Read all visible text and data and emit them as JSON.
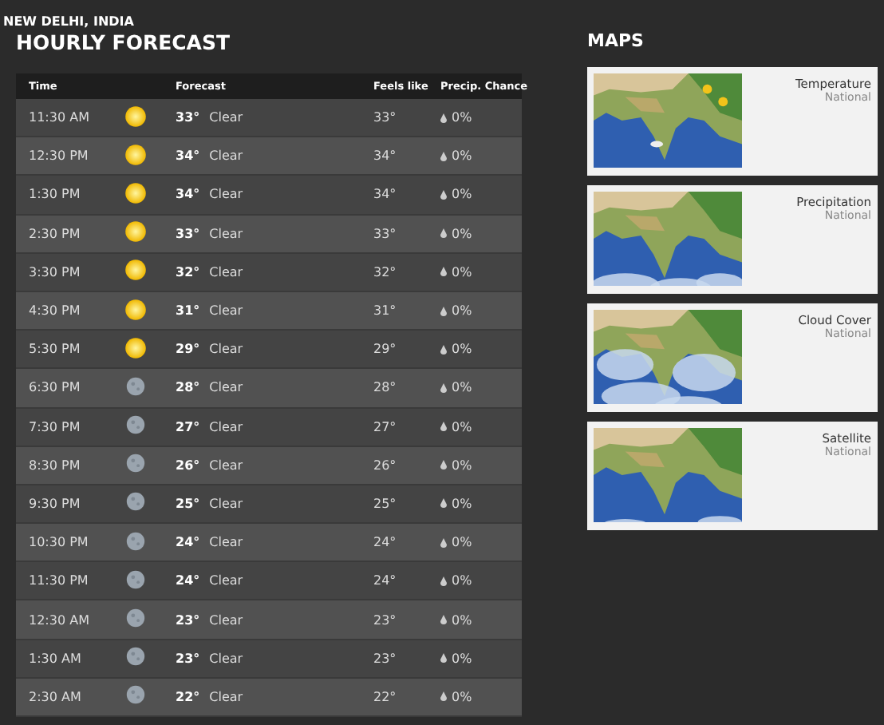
{
  "location": "NEW DELHI, INDIA",
  "title": "HOURLY FORECAST",
  "table": {
    "columns": [
      "Time",
      "Forecast",
      "Feels like",
      "Precip. Chance"
    ],
    "rows": [
      {
        "time": "11:30 AM",
        "kind": "sun",
        "temp": "33°",
        "condition": "Clear",
        "feels_like": "33°",
        "precip": "0%"
      },
      {
        "time": "12:30 PM",
        "kind": "sun",
        "temp": "34°",
        "condition": "Clear",
        "feels_like": "34°",
        "precip": "0%"
      },
      {
        "time": "1:30 PM",
        "kind": "sun",
        "temp": "34°",
        "condition": "Clear",
        "feels_like": "34°",
        "precip": "0%"
      },
      {
        "time": "2:30 PM",
        "kind": "sun",
        "temp": "33°",
        "condition": "Clear",
        "feels_like": "33°",
        "precip": "0%"
      },
      {
        "time": "3:30 PM",
        "kind": "sun",
        "temp": "32°",
        "condition": "Clear",
        "feels_like": "32°",
        "precip": "0%"
      },
      {
        "time": "4:30 PM",
        "kind": "sun",
        "temp": "31°",
        "condition": "Clear",
        "feels_like": "31°",
        "precip": "0%"
      },
      {
        "time": "5:30 PM",
        "kind": "sun",
        "temp": "29°",
        "condition": "Clear",
        "feels_like": "29°",
        "precip": "0%"
      },
      {
        "time": "6:30 PM",
        "kind": "moon",
        "temp": "28°",
        "condition": "Clear",
        "feels_like": "28°",
        "precip": "0%"
      },
      {
        "time": "7:30 PM",
        "kind": "moon",
        "temp": "27°",
        "condition": "Clear",
        "feels_like": "27°",
        "precip": "0%"
      },
      {
        "time": "8:30 PM",
        "kind": "moon",
        "temp": "26°",
        "condition": "Clear",
        "feels_like": "26°",
        "precip": "0%"
      },
      {
        "time": "9:30 PM",
        "kind": "moon",
        "temp": "25°",
        "condition": "Clear",
        "feels_like": "25°",
        "precip": "0%"
      },
      {
        "time": "10:30 PM",
        "kind": "moon",
        "temp": "24°",
        "condition": "Clear",
        "feels_like": "24°",
        "precip": "0%"
      },
      {
        "time": "11:30 PM",
        "kind": "moon",
        "temp": "24°",
        "condition": "Clear",
        "feels_like": "24°",
        "precip": "0%"
      },
      {
        "time": "12:30 AM",
        "kind": "moon",
        "temp": "23°",
        "condition": "Clear",
        "feels_like": "23°",
        "precip": "0%"
      },
      {
        "time": "1:30 AM",
        "kind": "moon",
        "temp": "23°",
        "condition": "Clear",
        "feels_like": "23°",
        "precip": "0%"
      },
      {
        "time": "2:30 AM",
        "kind": "moon",
        "temp": "22°",
        "condition": "Clear",
        "feels_like": "22°",
        "precip": "0%"
      }
    ]
  },
  "maps": {
    "title": "MAPS",
    "items": [
      {
        "name": "Temperature",
        "scope": "National"
      },
      {
        "name": "Precipitation",
        "scope": "National"
      },
      {
        "name": "Cloud Cover",
        "scope": "National"
      },
      {
        "name": "Satellite",
        "scope": "National"
      }
    ]
  }
}
